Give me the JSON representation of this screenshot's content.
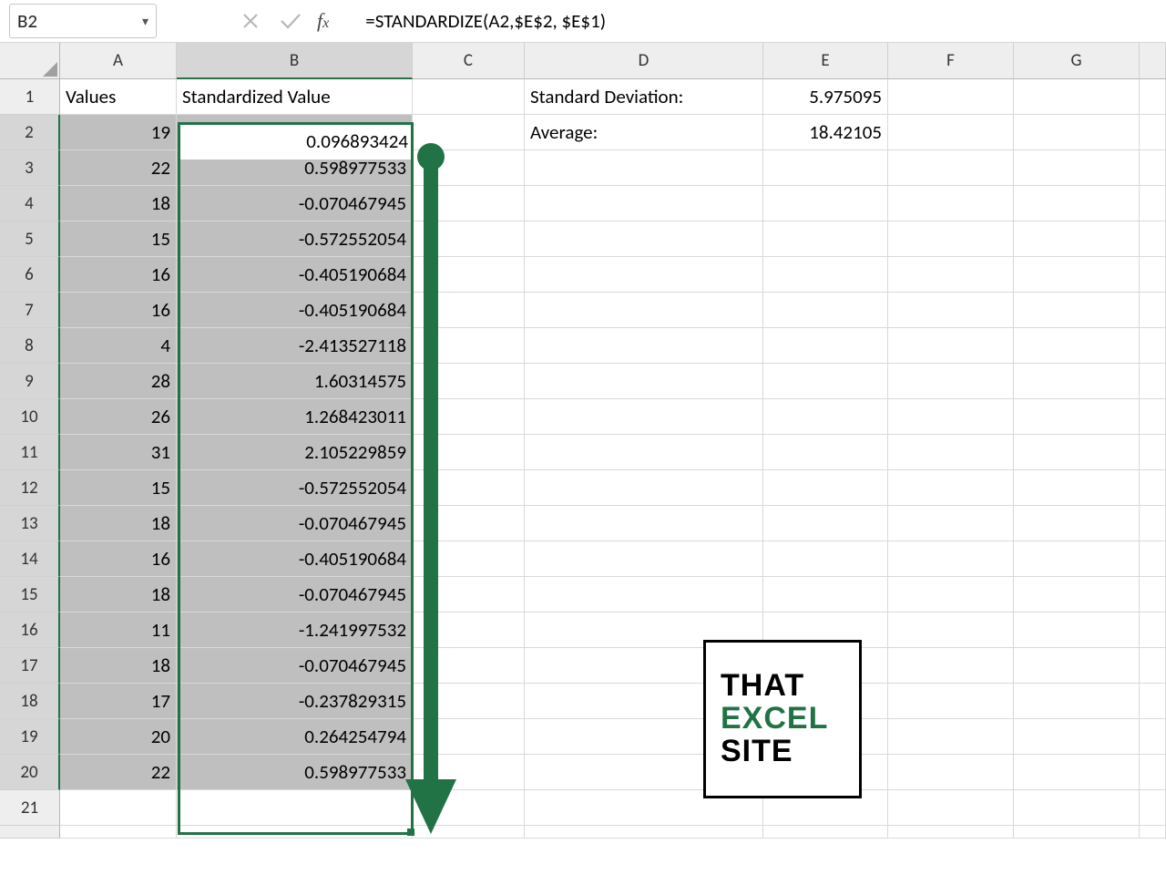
{
  "formula_bar": {
    "namebox": "B2",
    "formula": "=STANDARDIZE(A2,$E$2, $E$1)"
  },
  "columns": [
    "A",
    "B",
    "C",
    "D",
    "E",
    "F",
    "G"
  ],
  "headers": {
    "A1": "Values",
    "B1": "Standardized Value",
    "D1": "Standard Deviation:",
    "E1": "5.975095",
    "D2": "Average:",
    "E2": "18.42105"
  },
  "rows": [
    {
      "n": "1"
    },
    {
      "n": "2",
      "A": "19",
      "B": "0.096893424"
    },
    {
      "n": "3",
      "A": "22",
      "B": "0.598977533"
    },
    {
      "n": "4",
      "A": "18",
      "B": "-0.070467945"
    },
    {
      "n": "5",
      "A": "15",
      "B": "-0.572552054"
    },
    {
      "n": "6",
      "A": "16",
      "B": "-0.405190684"
    },
    {
      "n": "7",
      "A": "16",
      "B": "-0.405190684"
    },
    {
      "n": "8",
      "A": "4",
      "B": "-2.413527118"
    },
    {
      "n": "9",
      "A": "28",
      "B": "1.60314575"
    },
    {
      "n": "10",
      "A": "26",
      "B": "1.268423011"
    },
    {
      "n": "11",
      "A": "31",
      "B": "2.105229859"
    },
    {
      "n": "12",
      "A": "15",
      "B": "-0.572552054"
    },
    {
      "n": "13",
      "A": "18",
      "B": "-0.070467945"
    },
    {
      "n": "14",
      "A": "16",
      "B": "-0.405190684"
    },
    {
      "n": "15",
      "A": "18",
      "B": "-0.070467945"
    },
    {
      "n": "16",
      "A": "11",
      "B": "-1.241997532"
    },
    {
      "n": "17",
      "A": "18",
      "B": "-0.070467945"
    },
    {
      "n": "18",
      "A": "17",
      "B": "-0.237829315"
    },
    {
      "n": "19",
      "A": "20",
      "B": "0.264254794"
    },
    {
      "n": "20",
      "A": "22",
      "B": "0.598977533"
    },
    {
      "n": "21"
    }
  ],
  "logo": {
    "l1": "THAT",
    "l2": "EXCEL",
    "l3": "SITE"
  },
  "colors": {
    "excel_green": "#217346"
  }
}
